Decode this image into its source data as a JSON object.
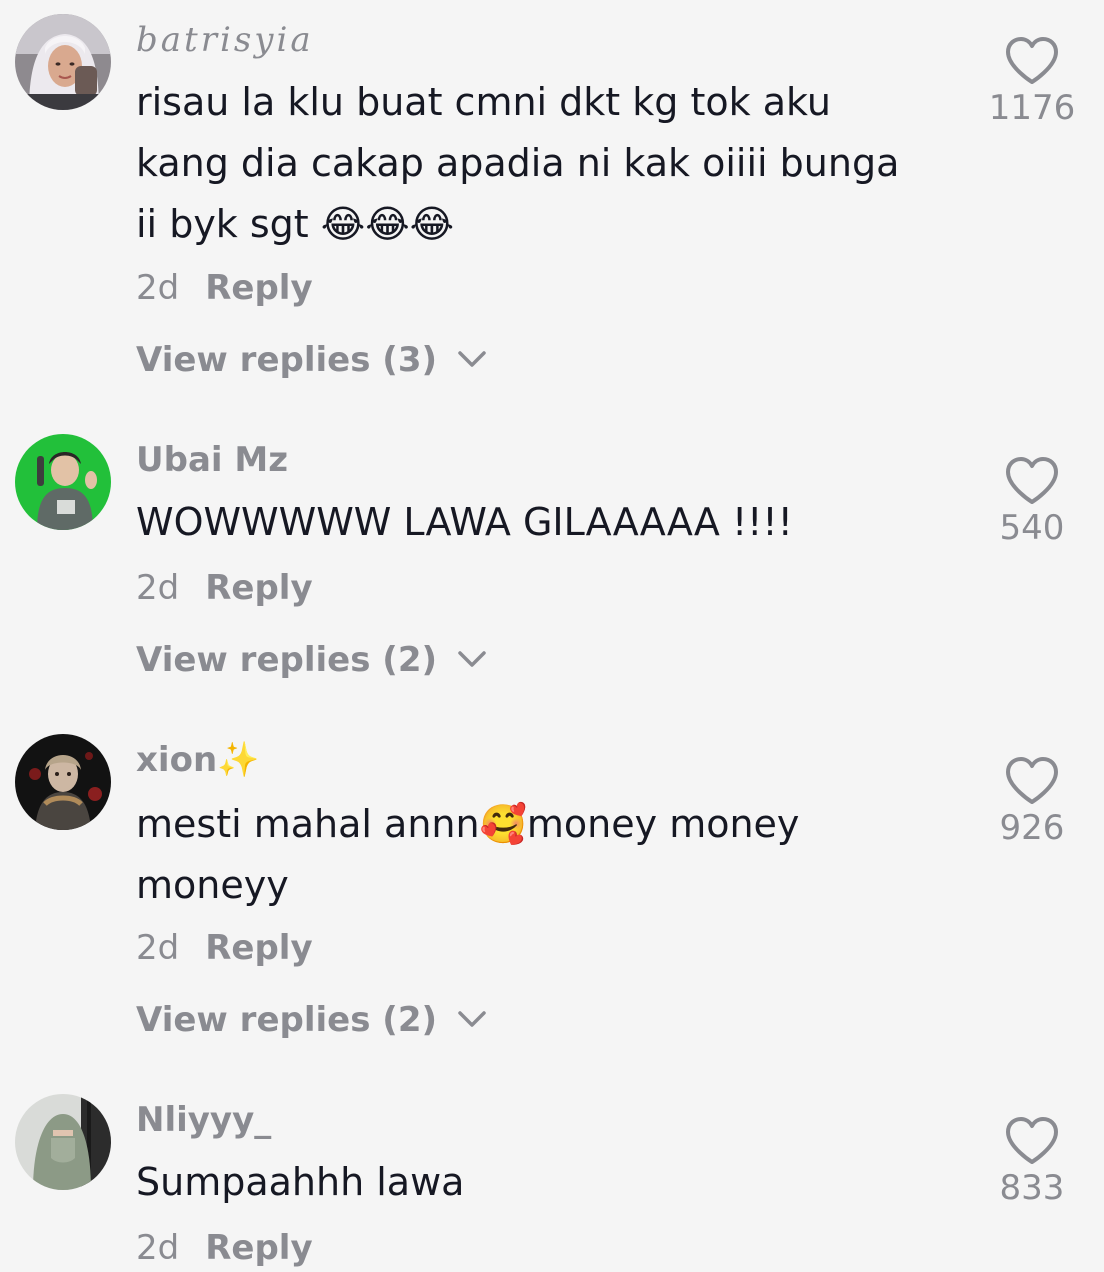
{
  "comments": [
    {
      "username": "batrisyia",
      "text": "risau la klu buat cmni dkt kg tok aku\nkang dia cakap apadia ni kak oiiii bunga\nii byk sgt 😂😂😂",
      "time": "2d",
      "reply_label": "Reply",
      "view_replies": "View replies (3)",
      "likes": "1176",
      "avatar_icon": "avatar-hijab-photo"
    },
    {
      "username": "Ubai Mz",
      "text": "WOWWWWW LAWA GILAAAAA !!!!",
      "time": "2d",
      "reply_label": "Reply",
      "view_replies": "View replies (2)",
      "likes": "540",
      "avatar_icon": "avatar-green-photo"
    },
    {
      "username": "xion✨",
      "text": "mesti mahal annn🥰money money\nmoneyy",
      "time": "2d",
      "reply_label": "Reply",
      "view_replies": "View replies (2)",
      "likes": "926",
      "avatar_icon": "avatar-dark-art"
    },
    {
      "username": "Nliyyy_",
      "text": "Sumpaahhh lawa",
      "time": "2d",
      "reply_label": "Reply",
      "likes": "833",
      "avatar_icon": "avatar-niqab-photo"
    }
  ],
  "colors": {
    "background": "#f5f5f5",
    "text_primary": "#161823",
    "text_secondary": "#8a8b91"
  }
}
